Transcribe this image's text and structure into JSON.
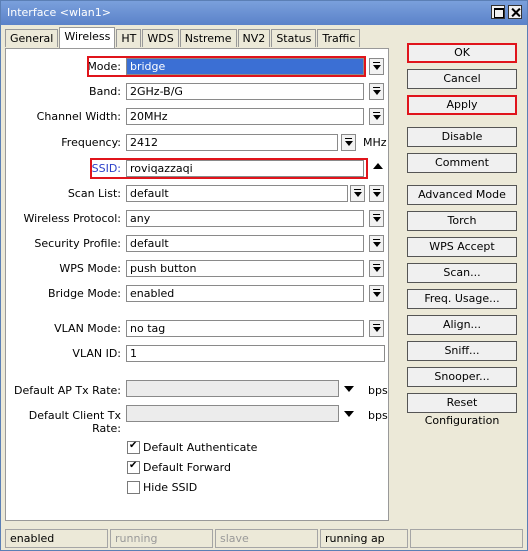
{
  "window": {
    "title": "Interface <wlan1>"
  },
  "tabs": [
    "General",
    "Wireless",
    "HT",
    "WDS",
    "Nstreme",
    "NV2",
    "Status",
    "Traffic"
  ],
  "form": {
    "mode": {
      "label": "Mode:",
      "value": "bridge"
    },
    "band": {
      "label": "Band:",
      "value": "2GHz-B/G"
    },
    "channel_width": {
      "label": "Channel Width:",
      "value": "20MHz"
    },
    "frequency": {
      "label": "Frequency:",
      "value": "2412",
      "unit": "MHz"
    },
    "ssid": {
      "label": "SSID:",
      "value": "roviqazzaqi"
    },
    "scan_list": {
      "label": "Scan List:",
      "value": "default"
    },
    "wireless_protocol": {
      "label": "Wireless Protocol:",
      "value": "any"
    },
    "security_profile": {
      "label": "Security Profile:",
      "value": "default"
    },
    "wps_mode": {
      "label": "WPS Mode:",
      "value": "push button"
    },
    "bridge_mode": {
      "label": "Bridge Mode:",
      "value": "enabled"
    },
    "vlan_mode": {
      "label": "VLAN Mode:",
      "value": "no tag"
    },
    "vlan_id": {
      "label": "VLAN ID:",
      "value": "1"
    },
    "default_ap_tx_rate": {
      "label": "Default AP Tx Rate:",
      "value": "",
      "unit": "bps"
    },
    "default_client_tx_rate": {
      "label": "Default Client Tx Rate:",
      "value": "",
      "unit": "bps"
    }
  },
  "checkboxes": [
    {
      "label": "Default Authenticate",
      "checked": true
    },
    {
      "label": "Default Forward",
      "checked": true
    },
    {
      "label": "Hide SSID",
      "checked": false
    }
  ],
  "buttons": [
    "OK",
    "Cancel",
    "Apply",
    "Disable",
    "Comment",
    "Advanced Mode",
    "Torch",
    "WPS Accept",
    "Scan...",
    "Freq. Usage...",
    "Align...",
    "Sniff...",
    "Snooper...",
    "Reset Configuration"
  ],
  "statusbar": [
    "enabled",
    "running",
    "slave",
    "running ap",
    ""
  ],
  "colors": {
    "highlight": "#e0141b",
    "selection": "#3b6fd4"
  }
}
